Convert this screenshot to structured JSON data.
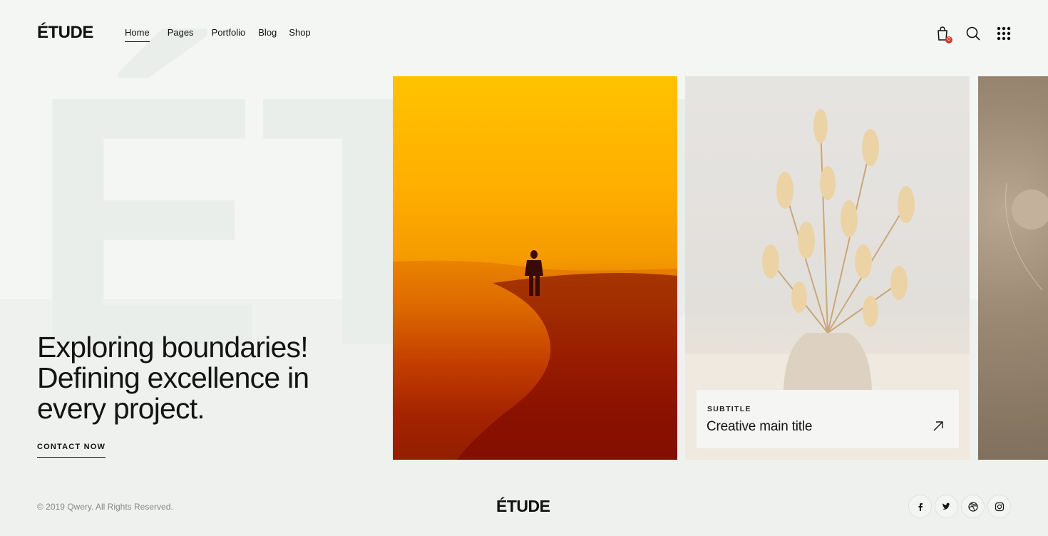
{
  "header": {
    "logo": "ÉTUDE",
    "nav": [
      "Home",
      "Pages",
      "Portfolio",
      "Blog",
      "Shop"
    ],
    "active_nav": "Home",
    "cart_count": "0",
    "icons": [
      "shopping-bag-icon",
      "search-icon",
      "grid-menu-icon"
    ]
  },
  "background": {
    "word": "ÉTUDE"
  },
  "hero": {
    "title_lines": [
      "Exploring boundaries!",
      "Defining excellence in",
      "every project."
    ],
    "cta": "CONTACT NOW"
  },
  "gallery": {
    "overlay": {
      "subtitle": "SUBTITLE",
      "title": "Creative main title"
    }
  },
  "footer": {
    "copyright": "© 2019 Qwery. All Rights Reserved.",
    "logo": "ÉTUDE",
    "socials": [
      "facebook-icon",
      "twitter-icon",
      "dribbble-icon",
      "instagram-icon"
    ]
  },
  "colors": {
    "text": "#141414",
    "background": "#eef1ed",
    "badge": "#d23c2a"
  }
}
